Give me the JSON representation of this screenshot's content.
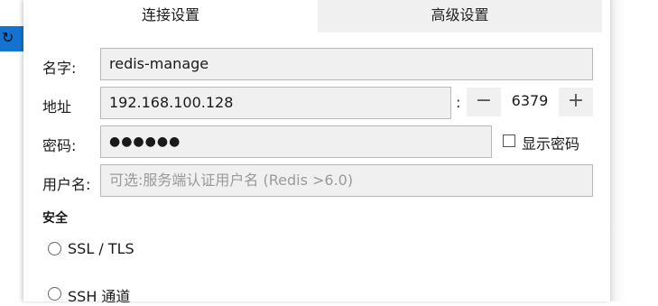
{
  "tabs": [
    {
      "label": "连接设置"
    },
    {
      "label": "高级设置"
    }
  ],
  "form": {
    "name": {
      "label": "名字:",
      "value": "redis-manage"
    },
    "address": {
      "label": "地址",
      "value": "192.168.100.128"
    },
    "port": {
      "separator": ":",
      "value": "6379",
      "decrement": "−",
      "increment": "+"
    },
    "password": {
      "label": "密码:",
      "value": "●●●●●●"
    },
    "show_password": {
      "label": "显示密码",
      "checked": false
    },
    "username": {
      "label": "用户名:",
      "placeholder": "可选:服务端认证用户名 (Redis >6.0)"
    }
  },
  "security": {
    "title": "安全",
    "options": [
      {
        "label": "SSL / TLS"
      },
      {
        "label": "SSH 通道"
      }
    ]
  }
}
